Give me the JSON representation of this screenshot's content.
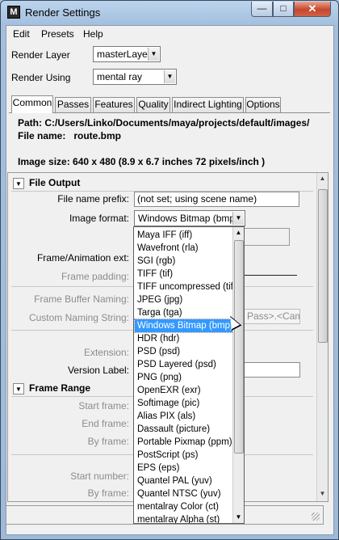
{
  "window": {
    "title": "Render Settings",
    "app_icon": "maya-icon",
    "close_glyph": "✕",
    "min_glyph": "—",
    "max_glyph": "□"
  },
  "menu": {
    "items": [
      "Edit",
      "Presets",
      "Help"
    ]
  },
  "render_layer": {
    "label": "Render Layer",
    "value": "masterLayer"
  },
  "render_using": {
    "label": "Render Using",
    "value": "mental ray"
  },
  "tabs": [
    "Common",
    "Passes",
    "Features",
    "Quality",
    "Indirect Lighting",
    "Options"
  ],
  "active_tab": "Common",
  "info": {
    "path": "Path: C:/Users/Linko/Documents/maya/projects/default/images/",
    "file_name": "File name:   route.bmp",
    "image_size": "Image size: 640 x 480 (8.9 x 6.7 inches 72 pixels/inch )"
  },
  "file_output": {
    "title": "File Output",
    "file_name_prefix_label": "File name prefix:",
    "file_name_prefix_value": "(not set; using scene name)",
    "image_format_label": "Image format:",
    "image_format_value": "Windows Bitmap (bmp)",
    "frame_animation_ext_label": "Frame/Animation ext:",
    "frame_padding_label": "Frame padding:",
    "frame_buffer_naming_label": "Frame Buffer Naming:",
    "custom_naming_string_label": "Custom Naming String:",
    "custom_naming_string_value": "Pass>.<Came",
    "extension_label": "Extension:",
    "version_label_label": "Version Label:"
  },
  "frame_range": {
    "title": "Frame Range",
    "start_frame_label": "Start frame:",
    "end_frame_label": "End frame:",
    "by_frame_label": "By frame:",
    "start_number_label": "Start number:",
    "by_frame_label_2": "By frame:"
  },
  "image_format_options": [
    "Maya IFF (iff)",
    "Wavefront (rla)",
    "SGI (rgb)",
    "TIFF (tif)",
    "TIFF uncompressed (tif)",
    "JPEG (jpg)",
    "Targa (tga)",
    "Windows Bitmap (bmp)",
    "HDR (hdr)",
    "PSD (psd)",
    "PSD Layered (psd)",
    "PNG (png)",
    "OpenEXR (exr)",
    "Softimage (pic)",
    "Alias PIX (als)",
    "Dassault (picture)",
    "Portable Pixmap (ppm)",
    "PostScript (ps)",
    "EPS (eps)",
    "Quantel PAL (yuv)",
    "Quantel NTSC (yuv)",
    "mentalray Color (ct)",
    "mentalray Alpha (st)"
  ],
  "selected_format_index": 7
}
